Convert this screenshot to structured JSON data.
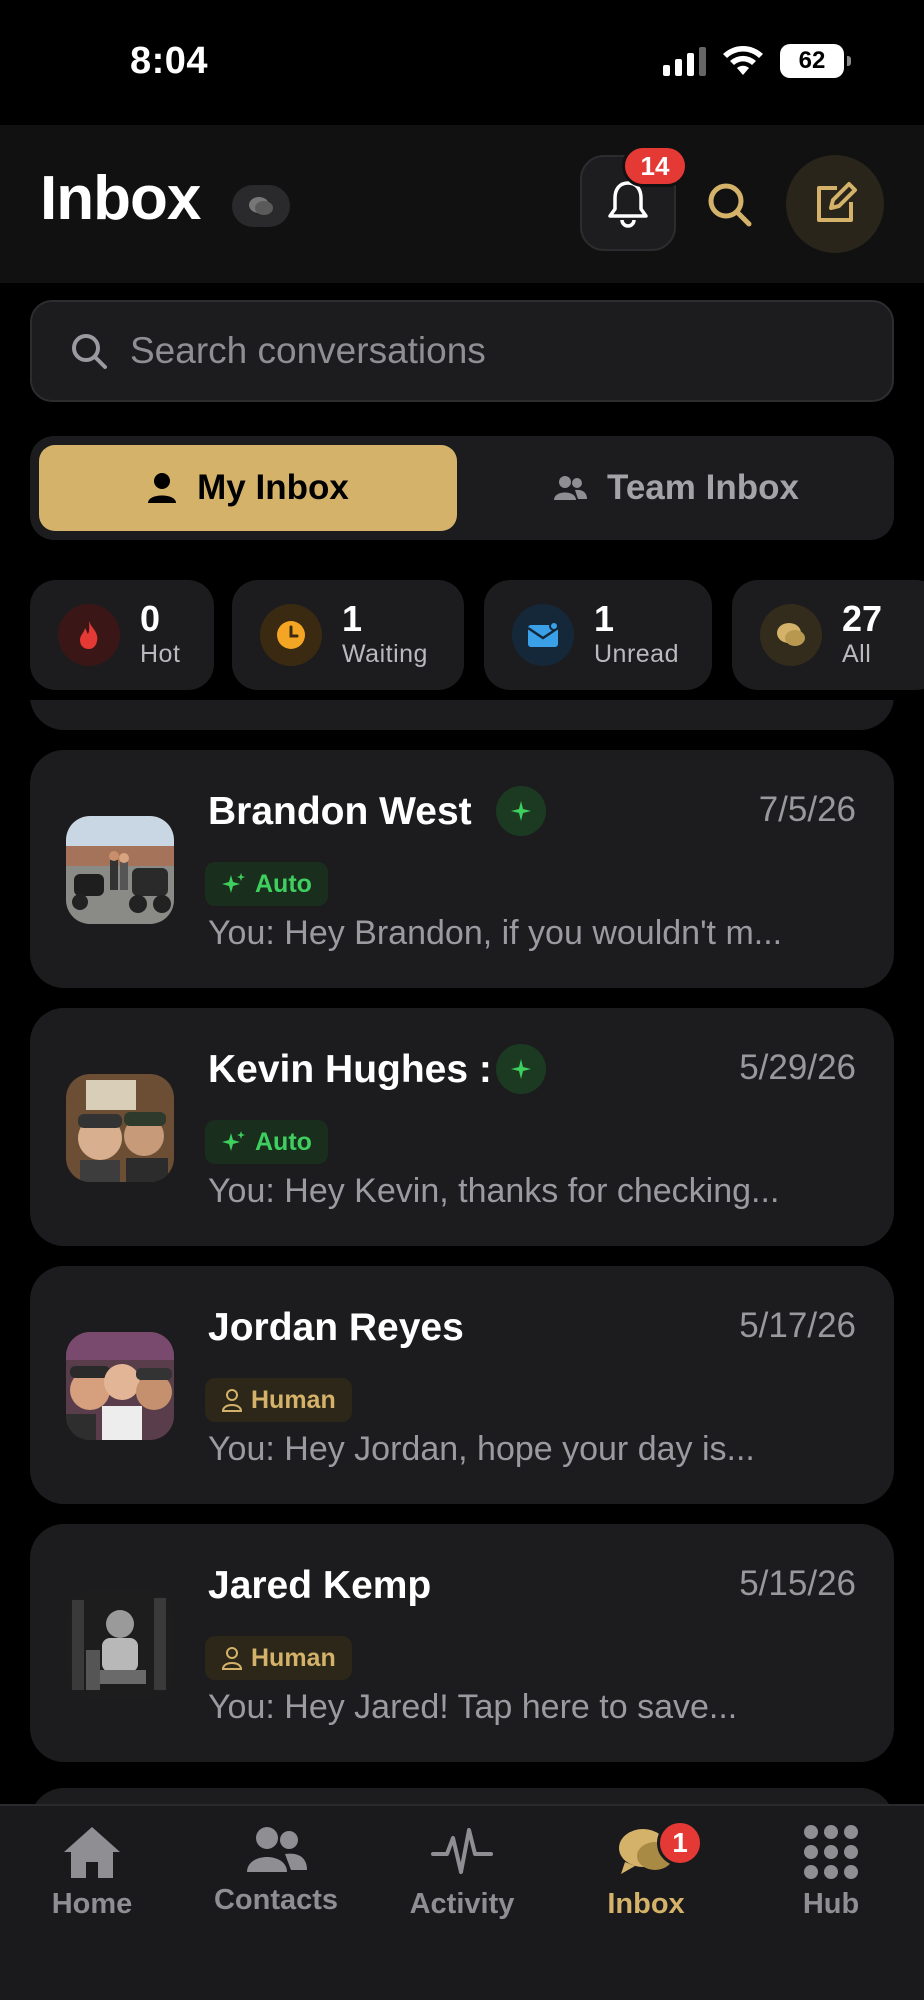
{
  "status_bar": {
    "time": "8:04",
    "battery": "62"
  },
  "header": {
    "title": "Inbox",
    "notification_count": "14"
  },
  "search": {
    "placeholder": "Search conversations"
  },
  "segments": [
    {
      "label": "My Inbox",
      "icon": "person-icon",
      "active": true
    },
    {
      "label": "Team Inbox",
      "icon": "people-icon",
      "active": false
    }
  ],
  "stats": [
    {
      "count": "0",
      "label": "Hot",
      "icon": "flame-icon",
      "color": "#e53935"
    },
    {
      "count": "1",
      "label": "Waiting",
      "icon": "clock-icon",
      "color": "#f5a524"
    },
    {
      "count": "1",
      "label": "Unread",
      "icon": "mail-icon",
      "color": "#3aa0e8"
    },
    {
      "count": "27",
      "label": "All",
      "icon": "chat-bubbles-icon",
      "color": "#d4b26a"
    }
  ],
  "conversations": [
    {
      "name": "Brandon West",
      "date": "7/5/26",
      "tag": "Auto",
      "preview": "You: Hey Brandon, if you wouldn't m...",
      "ai_badge": true
    },
    {
      "name": "Kevin Hughes :",
      "date": "5/29/26",
      "tag": "Auto",
      "preview": "You: Hey Kevin, thanks for checking...",
      "ai_badge": true
    },
    {
      "name": "Jordan Reyes",
      "date": "5/17/26",
      "tag": "Human",
      "preview": "You: Hey Jordan, hope your day is...",
      "ai_badge": false
    },
    {
      "name": "Jared Kemp",
      "date": "5/15/26",
      "tag": "Human",
      "preview": "You: Hey Jared! Tap here to save...",
      "ai_badge": false
    }
  ],
  "tabbar": {
    "items": [
      {
        "label": "Home",
        "icon": "house-icon"
      },
      {
        "label": "Contacts",
        "icon": "people-icon"
      },
      {
        "label": "Activity",
        "icon": "pulse-icon"
      },
      {
        "label": "Inbox",
        "icon": "chat-bubbles-icon",
        "active": true,
        "badge": "1"
      },
      {
        "label": "Hub",
        "icon": "grid-dots-icon"
      }
    ]
  },
  "colors": {
    "accent": "#d4b26a",
    "auto_green": "#3ecf5e",
    "badge_red": "#e53935"
  }
}
